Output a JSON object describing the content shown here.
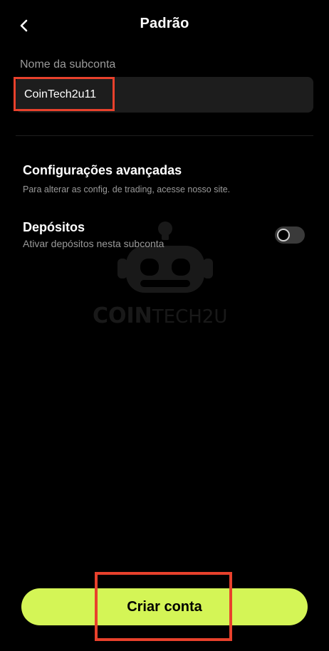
{
  "header": {
    "title": "Padrão",
    "back_icon": "chevron-left-icon"
  },
  "subaccount": {
    "label": "Nome da subconta",
    "value": "CoinTech2u11"
  },
  "advanced": {
    "title": "Configurações avançadas",
    "subtitle": "Para alterar as config. de trading, acesse nosso site."
  },
  "deposits": {
    "title": "Depósitos",
    "subtitle": "Ativar depósitos nesta subconta",
    "enabled": false
  },
  "watermark": {
    "text_bold": "COIN",
    "text_light": "TECH2U"
  },
  "footer": {
    "create_label": "Criar conta"
  },
  "colors": {
    "accent": "#d4f556",
    "highlight": "#e8412c",
    "background": "#000000"
  }
}
